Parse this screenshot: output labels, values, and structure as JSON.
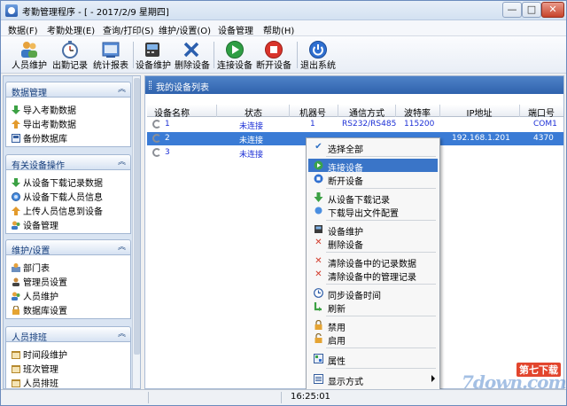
{
  "window": {
    "title": "考勤管理程序 - [ - 2017/2/9 星期四]",
    "min": "—",
    "max": "□",
    "close": "✕"
  },
  "menu": [
    "数据(F)",
    "考勤处理(E)",
    "查询/打印(S)",
    "维护/设置(O)",
    "设备管理",
    "帮助(H)"
  ],
  "toolbar": [
    {
      "label": "人员维护",
      "icon": "people-icon"
    },
    {
      "label": "出勤记录",
      "icon": "stopwatch-icon"
    },
    {
      "label": "统计报表",
      "icon": "report-icon"
    },
    {
      "label": "设备维护",
      "icon": "device-icon"
    },
    {
      "label": "删除设备",
      "icon": "delete-x-icon"
    },
    {
      "label": "连接设备",
      "icon": "play-green-icon"
    },
    {
      "label": "断开设备",
      "icon": "stop-red-icon"
    },
    {
      "label": "退出系统",
      "icon": "power-icon"
    }
  ],
  "sidebar": {
    "groups": [
      {
        "title": "数据管理",
        "items": [
          "导入考勤数据",
          "导出考勤数据",
          "备份数据库"
        ]
      },
      {
        "title": "有关设备操作",
        "items": [
          "从设备下载记录数据",
          "从设备下载人员信息",
          "上传人员信息到设备",
          "设备管理"
        ]
      },
      {
        "title": "维护/设置",
        "items": [
          "部门表",
          "管理员设置",
          "人员维护",
          "数据库设置"
        ]
      },
      {
        "title": "人员排班",
        "items": [
          "时间段维护",
          "班次管理",
          "人员排班"
        ]
      }
    ],
    "collapse_glyph": "︽"
  },
  "panel": {
    "title": "我的设备列表"
  },
  "grid": {
    "columns": [
      "设备名称",
      "状态",
      "机器号",
      "通信方式",
      "波特率",
      "IP地址",
      "端口号"
    ],
    "rows": [
      {
        "name": "1",
        "status": "未连接",
        "machine": "1",
        "comm": "RS232/RS485",
        "baud": "115200",
        "ip": "",
        "port": "COM1"
      },
      {
        "name": "2",
        "status": "未连接",
        "machine": "",
        "comm": "",
        "baud": "",
        "ip": "192.168.1.201",
        "port": "4370"
      },
      {
        "name": "3",
        "status": "未连接",
        "machine": "",
        "comm": "",
        "baud": "",
        "ip": "",
        "port": ""
      }
    ]
  },
  "context_menu": [
    {
      "label": "选择全部",
      "icon": "check-icon"
    },
    {
      "label": "连接设备",
      "icon": "connect-green-icon",
      "highlight": true
    },
    {
      "label": "断开设备",
      "icon": "disconnect-blue-icon"
    },
    {
      "label": "从设备下载记录",
      "icon": "download-green-icon"
    },
    {
      "label": "下载导出文件配置",
      "icon": "config-blue-icon"
    },
    {
      "label": "设备维护",
      "icon": "device-icon"
    },
    {
      "label": "删除设备",
      "icon": "delete-x-icon"
    },
    {
      "label": "清除设备中的记录数据",
      "icon": "delete-x-icon"
    },
    {
      "label": "清除设备中的管理记录",
      "icon": "delete-x-icon"
    },
    {
      "label": "同步设备时间",
      "icon": "clock-icon"
    },
    {
      "label": "刷新",
      "icon": "refresh-icon"
    },
    {
      "label": "禁用",
      "icon": "lock-icon"
    },
    {
      "label": "启用",
      "icon": "unlock-icon"
    },
    {
      "label": "属性",
      "icon": "properties-icon"
    },
    {
      "label": "显示方式",
      "icon": "display-mode-icon",
      "submenu": true
    }
  ],
  "status": {
    "time": "16:25:01"
  },
  "watermark": {
    "badge": "第七下载",
    "text": "7down.com"
  }
}
